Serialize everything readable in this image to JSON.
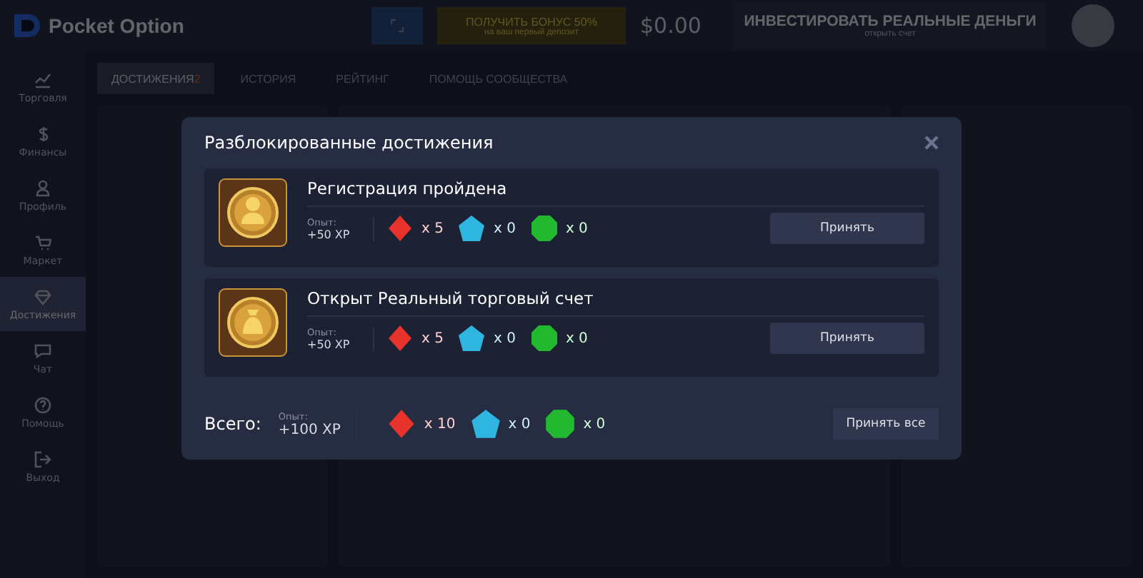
{
  "header": {
    "logo": "Pocket Option",
    "bonus": {
      "title": "ПОЛУЧИТЬ БОНУС 50%",
      "subtitle": "на ваш первый депозит"
    },
    "balance": "$0.00",
    "invest": {
      "title": "ИНВЕСТИРОВАТЬ РЕАЛЬНЫЕ ДЕНЬГИ",
      "subtitle": "открыть счет"
    }
  },
  "sidebar": {
    "items": [
      {
        "label": "Торговля",
        "kind": "chart",
        "selected": false
      },
      {
        "label": "Финансы",
        "kind": "dollar",
        "selected": false
      },
      {
        "label": "Профиль",
        "kind": "person",
        "selected": false
      },
      {
        "label": "Маркет",
        "kind": "cart",
        "selected": false
      },
      {
        "label": "Достижения",
        "kind": "diamond",
        "selected": true
      },
      {
        "label": "Чат",
        "kind": "chat",
        "selected": false
      },
      {
        "label": "Помощь",
        "kind": "help",
        "selected": false
      },
      {
        "label": "Выход",
        "kind": "exit",
        "selected": false
      }
    ]
  },
  "tabs": [
    {
      "label": "ДОСТИЖЕНИЯ",
      "badge": "2",
      "selected": true
    },
    {
      "label": "ИСТОРИЯ",
      "selected": false
    },
    {
      "label": "РЕЙТИНГ",
      "selected": false
    },
    {
      "label": "ПОМОЩЬ СООБЩЕСТВА",
      "selected": false
    }
  ],
  "modal": {
    "title": "Разблокированные достижения",
    "achievements": [
      {
        "title": "Регистрация пройдена",
        "kind": "person",
        "xp_label": "Опыт:",
        "xp": "+50 XP",
        "rewards": [
          {
            "kind": "red",
            "count": "x 5"
          },
          {
            "kind": "blue",
            "count": "x 0"
          },
          {
            "kind": "green",
            "count": "x 0"
          }
        ],
        "button": "Принять"
      },
      {
        "title": "Открыт Реальный торговый счет",
        "kind": "money-bag",
        "xp_label": "Опыт:",
        "xp": "+50 XP",
        "rewards": [
          {
            "kind": "red",
            "count": "x 5"
          },
          {
            "kind": "blue",
            "count": "x 0"
          },
          {
            "kind": "green",
            "count": "x 0"
          }
        ],
        "button": "Принять"
      }
    ],
    "total": {
      "label": "Всего:",
      "xp_label": "Опыт:",
      "xp": "+100 XP",
      "rewards": [
        {
          "kind": "red",
          "count": "x 10"
        },
        {
          "kind": "blue",
          "count": "x 0"
        },
        {
          "kind": "green",
          "count": "x 0"
        }
      ],
      "button": "Принять все"
    }
  }
}
